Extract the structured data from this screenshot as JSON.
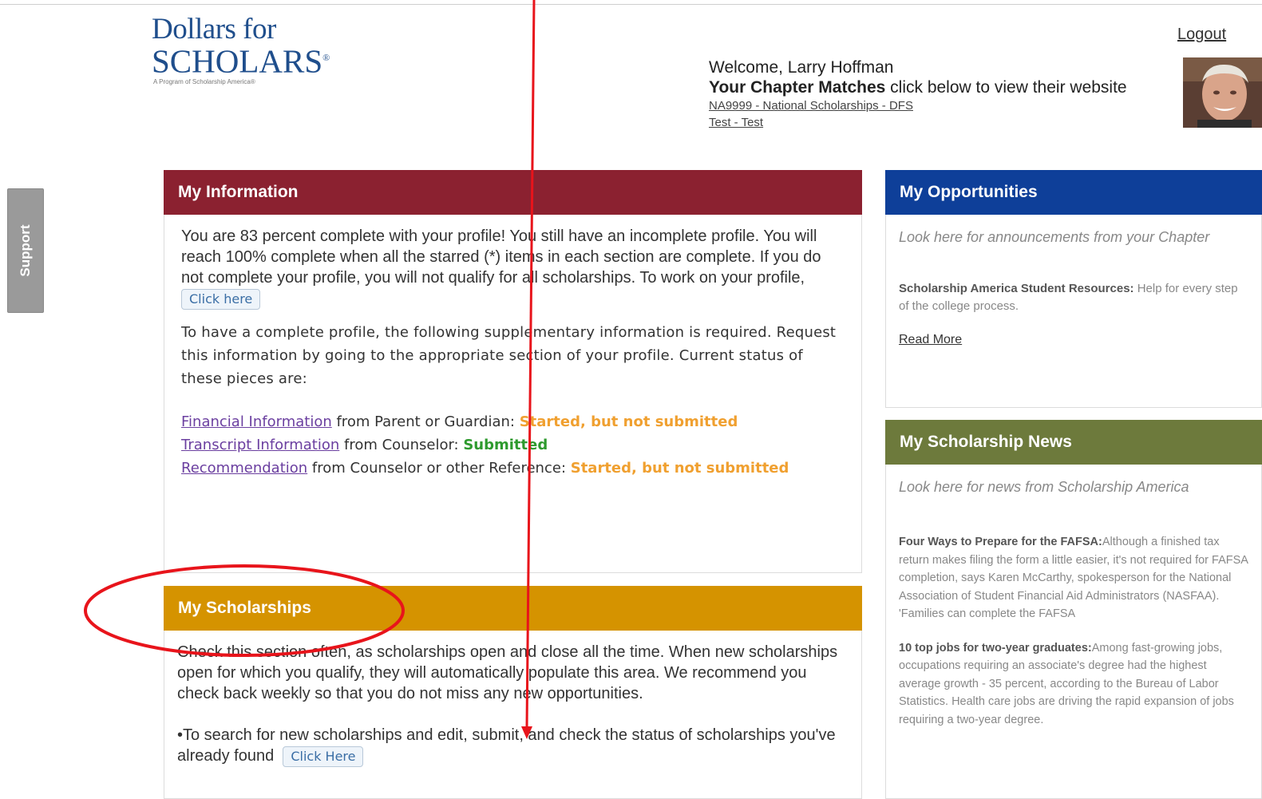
{
  "logo": {
    "line1": "Dollars for",
    "line2": "SCHOLARS",
    "reg": "®",
    "tagline": "A Program of Scholarship America®"
  },
  "header": {
    "logout": "Logout",
    "welcome": "Welcome, Larry Hoffman",
    "matches_bold": "Your Chapter Matches",
    "matches_rest": " click below to view their website",
    "chapter_links": [
      "NA9999 - National Scholarships - DFS",
      "Test - Test"
    ]
  },
  "support_tab": "Support",
  "my_information": {
    "title": "My Information",
    "intro": "You are 83 percent complete with your profile! You still have an incomplete profile. You will reach 100% complete when all the starred (*) items in each section are complete. If you do not complete your profile, you will not qualify for all scholarships. To work on your profile,",
    "click_here": "Click here",
    "supplementary": "To have a complete profile, the following supplementary information is required. Request this information by going to the appropriate section of your profile. Current status of these pieces are:",
    "statuses": [
      {
        "link": "Financial Information",
        "from": " from Parent or Guardian: ",
        "status": "Started, but not submitted",
        "color": "#f0a030"
      },
      {
        "link": "Transcript Information",
        "from": " from Counselor: ",
        "status": "Submitted",
        "color": "#2e9a2e"
      },
      {
        "link": "Recommendation",
        "from": " from Counselor or other Reference: ",
        "status": "Started, but not submitted",
        "color": "#f0a030"
      }
    ]
  },
  "my_scholarships": {
    "title": "My Scholarships",
    "text1": "Check this section often, as scholarships open and close all the time.  When new scholarships open for which you qualify, they will automatically populate this area.  We recommend you check back weekly so that you do not miss any new opportunities.",
    "text2": "•To search for new scholarships and edit, submit, and check the status of scholarships you've already found",
    "click_here": "Click Here"
  },
  "my_opportunities": {
    "title": "My Opportunities",
    "intro": "Look here for announcements from your Chapter",
    "resource_bold": "Scholarship America Student Resources:",
    "resource_text": " Help for every step of the college process.",
    "read_more": "Read More"
  },
  "my_scholarship_news": {
    "title": "My Scholarship News",
    "intro": "Look here for news from Scholarship America",
    "items": [
      {
        "headline": "Four Ways to Prepare for the FAFSA:",
        "text": "Although a finished tax return makes filing the form a little easier, it's not required for FAFSA completion, says Karen McCarthy, spokesperson for the National Association of Student Financial Aid Administrators (NASFAA). 'Families can complete the FAFSA"
      },
      {
        "headline": "10 top jobs for two-year graduates:",
        "text": "Among fast-growing jobs, occupations requiring an associate's degree had the highest average growth - 35 percent, according to the Bureau of Labor Statistics. Health care jobs are driving the rapid expansion of jobs requiring a two-year degree."
      }
    ]
  },
  "colors": {
    "my_information": "#8b2130",
    "my_scholarships": "#d59300",
    "my_opportunities": "#0e3f99",
    "my_scholarship_news": "#6d7a3c",
    "annotation": "#e8141b"
  }
}
